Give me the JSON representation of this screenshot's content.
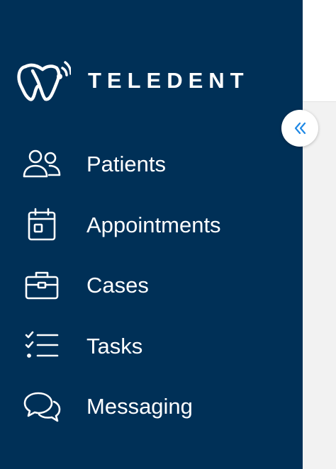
{
  "brand": {
    "name": "TELEDENT",
    "logo_icon": "tooth-signal-logo"
  },
  "sidebar": {
    "items": [
      {
        "label": "Patients",
        "icon": "users-icon"
      },
      {
        "label": "Appointments",
        "icon": "calendar-icon"
      },
      {
        "label": "Cases",
        "icon": "briefcase-icon"
      },
      {
        "label": "Tasks",
        "icon": "checklist-icon"
      },
      {
        "label": "Messaging",
        "icon": "chat-bubbles-icon"
      }
    ]
  },
  "collapse": {
    "icon": "chevrons-left-icon"
  },
  "colors": {
    "sidebar_bg": "#003057",
    "text": "#ffffff",
    "accent": "#1e88e5",
    "page_bg": "#f2f2f2"
  }
}
